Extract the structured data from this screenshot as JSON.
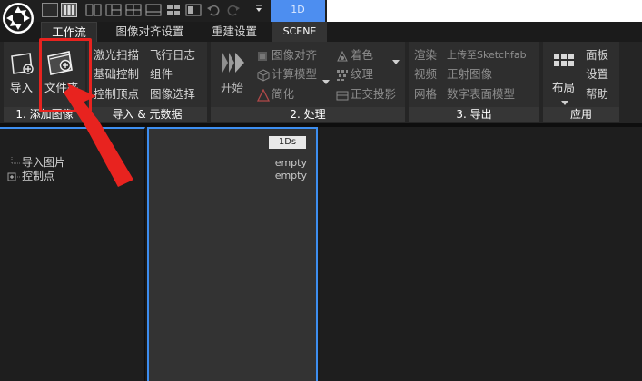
{
  "topbar": {
    "tab_1d": "1D"
  },
  "tabs": [
    {
      "label": "工作流"
    },
    {
      "label": "图像对齐设置"
    },
    {
      "label": "重建设置"
    },
    {
      "label": "SCENE"
    }
  ],
  "groups": {
    "add_images": {
      "label": "1. 添加图像",
      "import_label": "导入",
      "folder_label": "文件夹"
    },
    "import_meta": {
      "label": "导入 & 元数据",
      "items": [
        "激光扫描",
        "飞行日志",
        "基础控制",
        "组件",
        "控制顶点",
        "图像选择"
      ]
    },
    "process": {
      "label": "2. 处理",
      "start_label": "开始",
      "items": [
        "图像对齐",
        "着色",
        "计算模型",
        "纹理",
        "简化",
        "正交投影"
      ]
    },
    "export": {
      "label": "3. 导出",
      "items": [
        "渲染",
        "上传至Sketchfab",
        "视频",
        "正射图像",
        "网格",
        "数字表面模型"
      ]
    },
    "app": {
      "label": "应用",
      "layout_label": "布局",
      "items": [
        "面板",
        "设置",
        "帮助"
      ]
    }
  },
  "tree": {
    "items": [
      "导入图片",
      "控制点"
    ]
  },
  "viewport": {
    "badge": "1Ds",
    "line1": "empty",
    "line2": "empty"
  },
  "colors": {
    "accent_blue": "#3d8ef0",
    "annotation_red": "#e8231f",
    "ribbon_bg": "#2e2e2e"
  }
}
